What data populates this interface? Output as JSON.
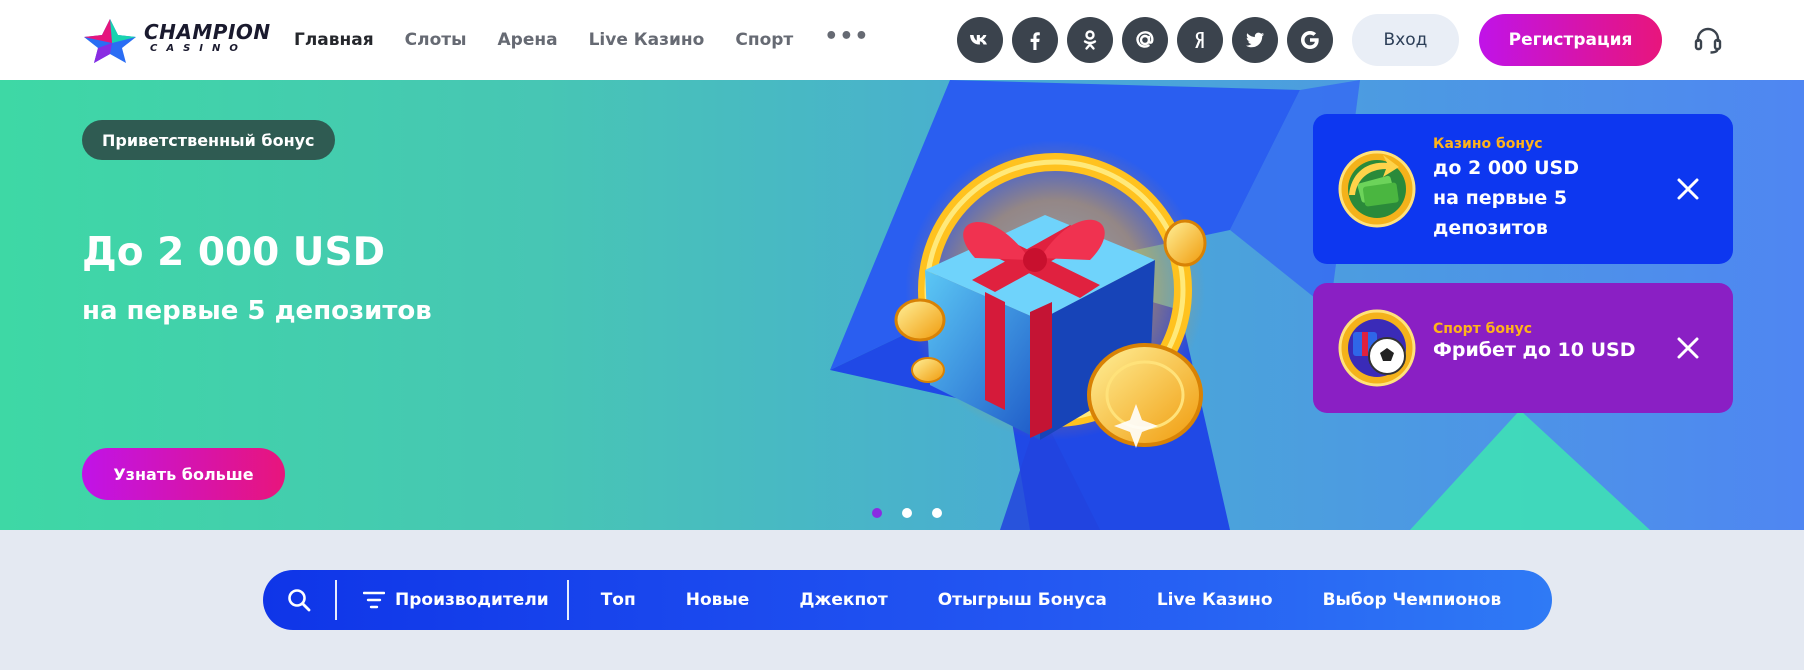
{
  "header": {
    "logo": {
      "main": "CHAMPION",
      "sub": "CASINO"
    },
    "nav": [
      {
        "label": "Главная",
        "active": true
      },
      {
        "label": "Слоты"
      },
      {
        "label": "Арена"
      },
      {
        "label": "Live Казино"
      },
      {
        "label": "Спорт"
      }
    ],
    "more_label": "•••",
    "socials": [
      {
        "name": "vk-icon",
        "glyph": "vk"
      },
      {
        "name": "facebook-icon",
        "glyph": "f"
      },
      {
        "name": "odnoklassniki-icon",
        "glyph": "ok"
      },
      {
        "name": "mail-icon",
        "glyph": "@"
      },
      {
        "name": "yandex-icon",
        "glyph": "Я"
      },
      {
        "name": "twitter-icon",
        "glyph": "tw"
      },
      {
        "name": "google-icon",
        "glyph": "G"
      }
    ],
    "login_label": "Вход",
    "register_label": "Регистрация"
  },
  "banner": {
    "badge": "Приветственный бонус",
    "headline": "До 2 000 USD",
    "subline": "на первые 5 депозитов",
    "cta_label": "Узнать больше",
    "slides_count": 3,
    "active_slide": 1
  },
  "promos": {
    "casino": {
      "label": "Казино бонус",
      "lines": [
        "до 2 000 USD",
        "на первые 5",
        "депозитов"
      ]
    },
    "sport": {
      "label": "Спорт бонус",
      "lines": [
        "Фрибет до 10 USD"
      ]
    }
  },
  "categories": {
    "filter_label": "Производители",
    "items": [
      "Топ",
      "Новые",
      "Джекпот",
      "Отыгрыш Бонуса",
      "Live Казино",
      "Выбор Чемпионов"
    ]
  },
  "colors": {
    "accent_gradient_start": "#c013e8",
    "accent_gradient_end": "#e8157c",
    "casino_promo_bg": "#0d37f0",
    "sport_promo_bg": "#8a1fc4",
    "promo_label": "#ffb31a"
  }
}
